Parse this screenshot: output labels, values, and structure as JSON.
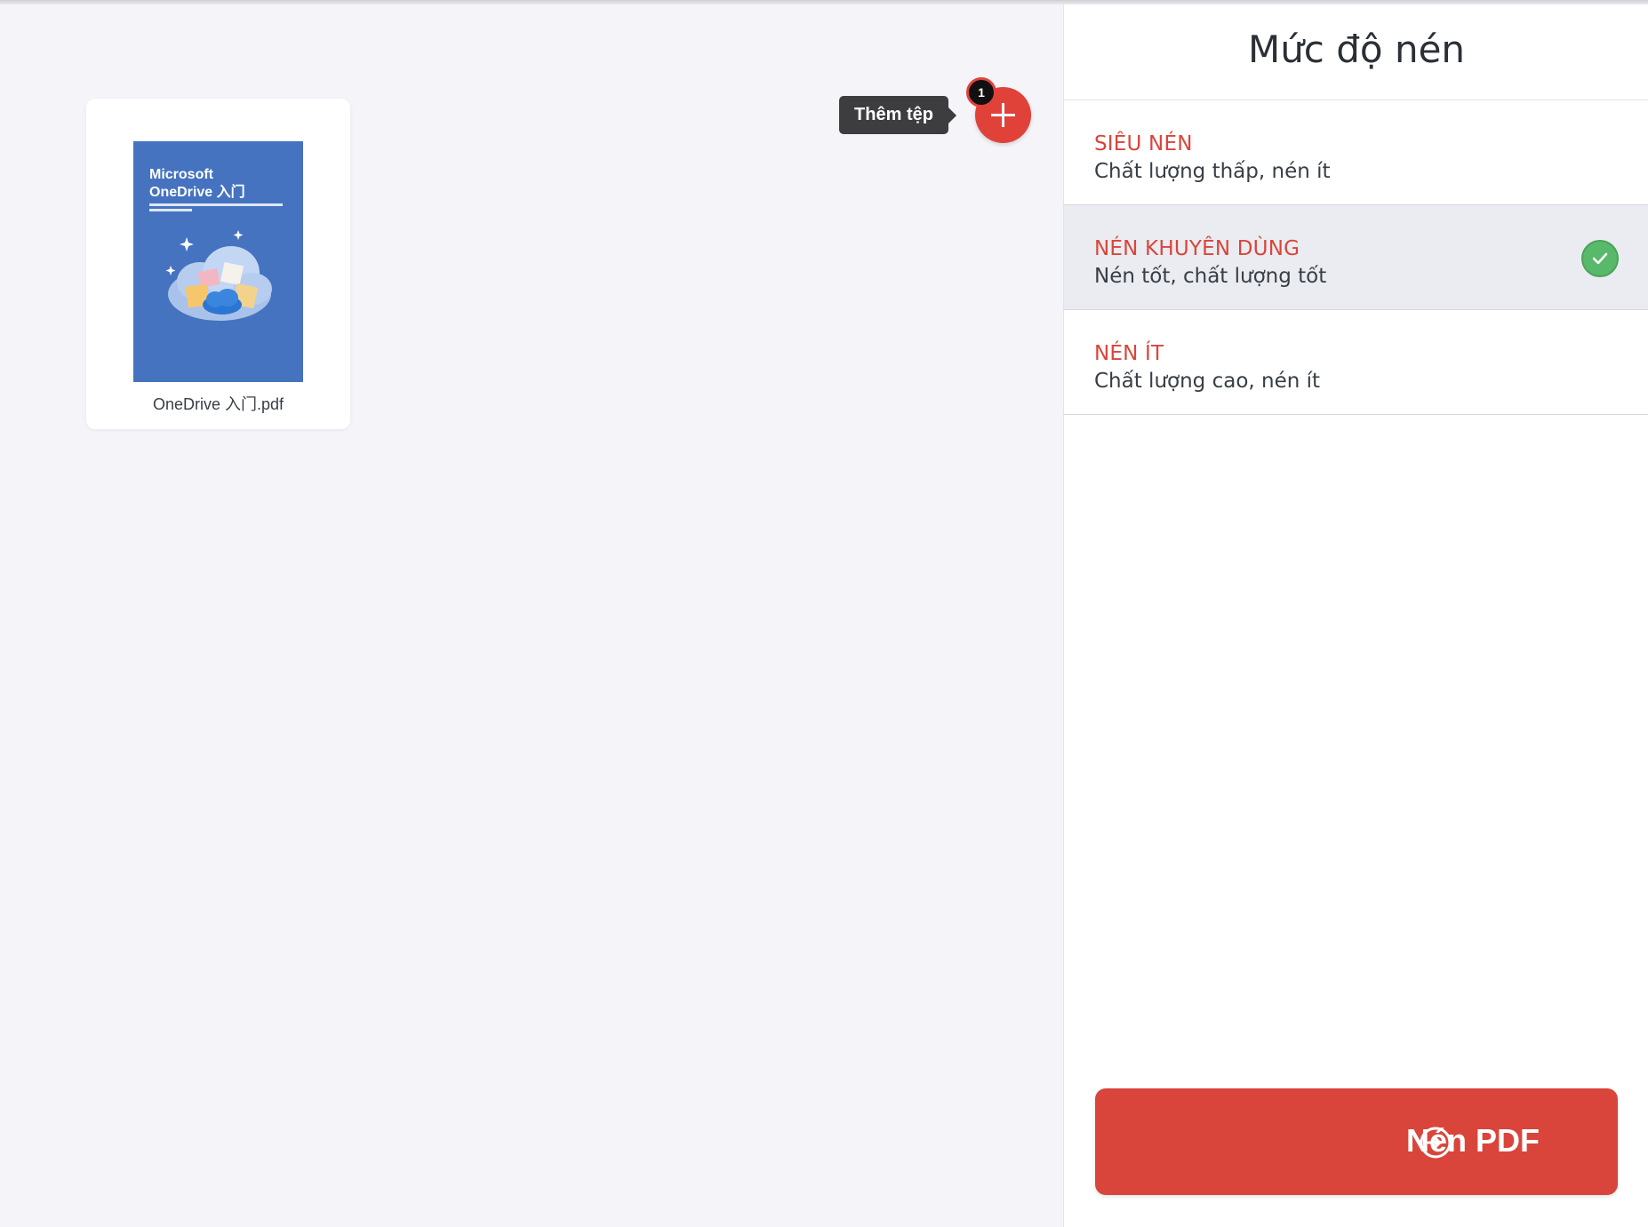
{
  "upload": {
    "add_tooltip": "Thêm tệp",
    "file_count": "1"
  },
  "files": [
    {
      "name": "OneDrive 入门.pdf",
      "thumbnail_title": "Microsoft\nOneDrive 入门",
      "thumbnail_color": "#4573c0"
    }
  ],
  "sidebar": {
    "title": "Mức độ nén",
    "options": [
      {
        "title": "SIÊU NÉN",
        "description": "Chất lượng thấp, nén ít",
        "selected": false
      },
      {
        "title": "NÉN KHUYÊN DÙNG",
        "description": "Nén tốt, chất lượng tốt",
        "selected": true
      },
      {
        "title": "NÉN ÍT",
        "description": "Chất lượng cao, nén ít",
        "selected": false
      }
    ],
    "action_label": "Nén PDF"
  },
  "colors": {
    "accent": "#d9453b",
    "success": "#58b96a",
    "background": "#f4f4f9"
  },
  "icons": {
    "add": "plus-icon",
    "selected": "check-icon",
    "action": "arrow-right-circle-icon"
  }
}
